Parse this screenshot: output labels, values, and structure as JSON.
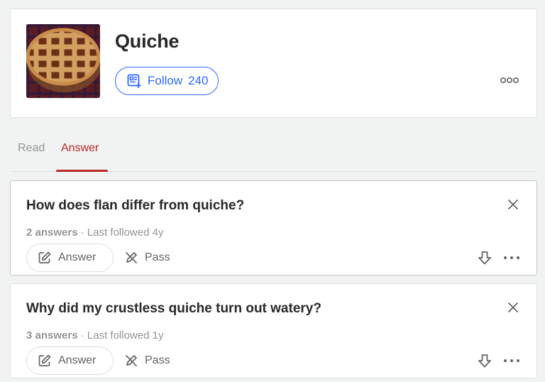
{
  "topic": {
    "title": "Quiche",
    "follow_label": "Follow",
    "follow_count": "240"
  },
  "tabs": [
    {
      "label": "Read",
      "active": false
    },
    {
      "label": "Answer",
      "active": true
    }
  ],
  "questions": [
    {
      "title": "How does flan differ from quiche?",
      "answers": "2 answers",
      "separator": "·",
      "last_followed": "Last followed 4y",
      "answer_label": "Answer",
      "pass_label": "Pass"
    },
    {
      "title": "Why did my crustless quiche turn out watery?",
      "answers": "3 answers",
      "separator": "·",
      "last_followed": "Last followed 1y",
      "answer_label": "Answer",
      "pass_label": "Pass"
    }
  ],
  "colors": {
    "accent_blue": "#2e69ff",
    "accent_red": "#b92b27",
    "text_dark": "#282829",
    "text_muted": "#939598"
  },
  "icons": {
    "follow": "topic-follow-icon",
    "more": "more-options-icon",
    "close": "close-icon",
    "answer": "pencil-edit-icon",
    "pass": "pencil-slash-icon",
    "downvote": "downvote-arrow-icon"
  }
}
